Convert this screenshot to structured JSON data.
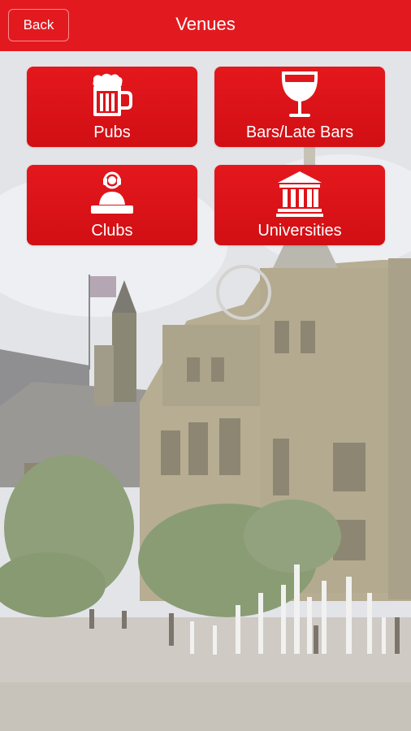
{
  "header": {
    "back_label": "Back",
    "title": "Venues"
  },
  "tiles": [
    {
      "label": "Pubs",
      "icon": "beer-mug-icon"
    },
    {
      "label": "Bars/Late Bars",
      "icon": "wine-glass-icon"
    },
    {
      "label": "Clubs",
      "icon": "dj-icon"
    },
    {
      "label": "Universities",
      "icon": "university-building-icon"
    }
  ],
  "colors": {
    "accent": "#e21a1f",
    "tile": "#dc1419",
    "text": "#ffffff"
  }
}
